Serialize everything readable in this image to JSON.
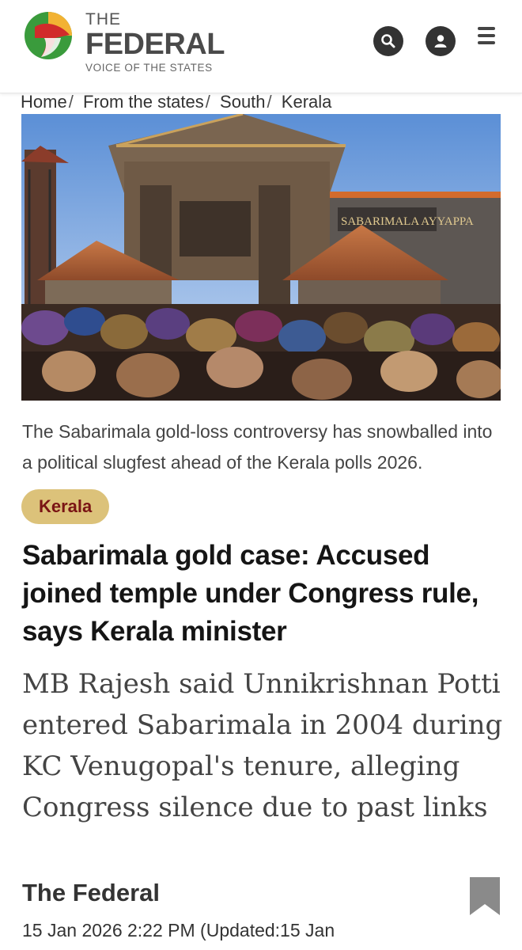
{
  "brand": {
    "the": "THE",
    "name": "FEDERAL",
    "tagline": "VOICE OF THE STATES",
    "colors": {
      "green": "#3a9b3c",
      "red": "#d12b2b",
      "yellow": "#f2b233",
      "dark": "#4a4a4a"
    }
  },
  "header": {
    "icons": {
      "search": "search-icon",
      "account": "user-icon",
      "menu": "hamburger-menu-icon"
    }
  },
  "breadcrumb": [
    "Home",
    "From the states",
    "South",
    "Kerala"
  ],
  "breadcrumb_separator": "/",
  "hero": {
    "sign_text": "SABARIMALA AYYAPPA"
  },
  "caption": "The Sabarimala gold-loss controversy has snowballed into a political slugfest ahead of the Kerala polls 2026.",
  "category_tag": "Kerala",
  "headline": "Sabarimala gold case: Accused joined temple under Congress rule, says Kerala minister",
  "summary": "MB Rajesh said Unnikrishnan Potti entered Sabarimala in 2004 during KC Venugopal's tenure, alleging Congress silence due to past links",
  "author": "The Federal",
  "dateline": "15 Jan 2026 2:22 PM  (Updated:15 Jan"
}
